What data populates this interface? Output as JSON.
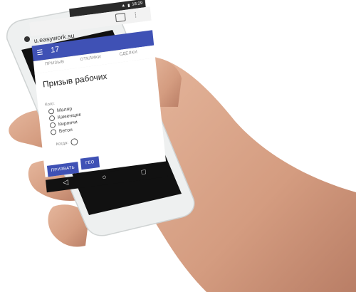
{
  "status_bar": {
    "time": "18:29"
  },
  "browser": {
    "url": "u.easywork.su",
    "tab_count": ""
  },
  "app_bar": {
    "title": "17"
  },
  "tabs": [
    "ПРИЗЫВ",
    "ОТКЛИКИ",
    "СДЕЛКИ"
  ],
  "card": {
    "title": "Призыв рабочих",
    "who_label": "Кого:",
    "options": [
      "Маляр",
      "Каменщик",
      "Кирпичи",
      "Бетон"
    ],
    "when_label": "Когда:"
  },
  "buttons": {
    "call": "ПРИЗВАТЬ",
    "geo": "ГЕО"
  },
  "nav": {
    "back": "◁",
    "home": "○",
    "recent": "□"
  },
  "colors": {
    "primary": "#3f51b5",
    "skin": "#d9a58a",
    "skin_shadow": "#b97e66",
    "phone_body": "#e9eaea",
    "bezel": "#111111"
  }
}
